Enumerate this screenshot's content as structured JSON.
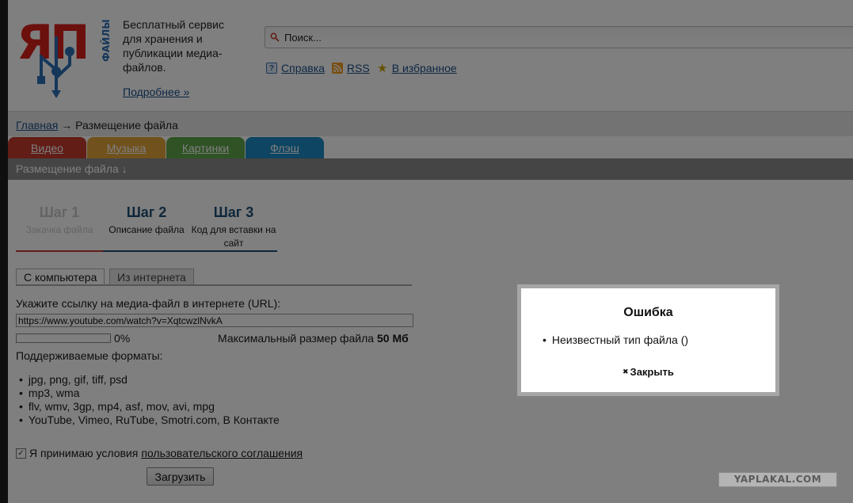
{
  "header": {
    "logo_text": "ЯП",
    "logo_side_text": "ФАЙЛЫ",
    "tagline": "Бесплатный сервис для хранения и публикации медиа-файлов.",
    "more_link": "Подробнее »",
    "search_placeholder": "Поиск...",
    "links": [
      {
        "label": "Справка",
        "icon": "help-icon"
      },
      {
        "label": "RSS",
        "icon": "rss-icon"
      },
      {
        "label": "В избранное",
        "icon": "star-icon"
      }
    ]
  },
  "breadcrumb": {
    "home": "Главная",
    "separator": "→",
    "current": "Размещение файла"
  },
  "tabs": [
    {
      "label": "Видео",
      "color": "#c23a2c"
    },
    {
      "label": "Музыка",
      "color": "#e3a43b"
    },
    {
      "label": "Картинки",
      "color": "#5fa648"
    },
    {
      "label": "Флэш",
      "color": "#1a8ac4"
    }
  ],
  "subbar": {
    "label": "Размещение файла ↓"
  },
  "steps": [
    {
      "title": "Шаг 1",
      "desc": "Закачка файла",
      "color": "#c9c9c9"
    },
    {
      "title": "Шаг 2",
      "desc": "Описание файла",
      "color": "#1e4e74"
    },
    {
      "title": "Шаг 3",
      "desc": "Код для вставки на сайт",
      "color": "#1e4e74"
    }
  ],
  "source_tabs": [
    {
      "label": "С компьютера",
      "active": true
    },
    {
      "label": "Из интернета",
      "active": false
    }
  ],
  "form": {
    "url_label": "Укажите ссылку на медиа-файл в интернете (URL):",
    "url_value": "https://www.youtube.com/watch?v=XqtcwzlNvkA",
    "progress_percent": 0,
    "progress_text": "0%",
    "max_size_label": "Максимальный размер файла",
    "max_size_value": "50 Мб",
    "formats_label": "Поддерживаемые форматы:",
    "formats": [
      "jpg, png, gif, tiff, psd",
      "mp3, wma",
      "flv, wmv, 3gp, mp4, asf, mov, avi, mpg",
      "YouTube, Vimeo, RuTube, Smotri.com, В Контакте"
    ],
    "agree_text": "Я принимаю условия",
    "agree_link": "пользовательского соглашения",
    "agree_checked": true,
    "upload_button": "Загрузить"
  },
  "modal": {
    "title": "Ошибка",
    "error": "Неизвестный тип файла ()",
    "close_label": "Закрыть"
  },
  "watermark": "YAPLAKAL.COM"
}
